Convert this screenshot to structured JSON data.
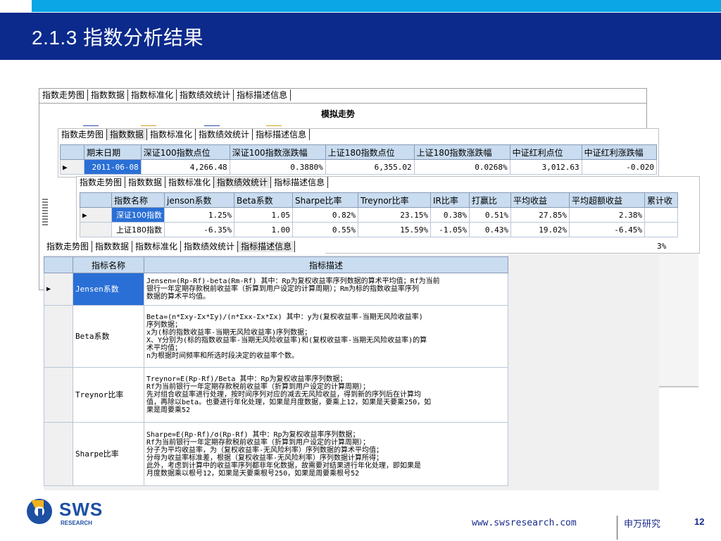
{
  "slide": {
    "title": "2.1.3 指数分析结果",
    "page_number": "12",
    "footer_url": "www.swsresearch.com",
    "footer_company": "申万研究",
    "logo_text": "SWS",
    "logo_subtext": "RESEARCH",
    "colors": {
      "header_band": "#0b2a8c",
      "top_strip": "#0aa6e6",
      "grid_header": "#c9dcf0",
      "selected": "#2a6fd6"
    }
  },
  "window1": {
    "tabs": [
      "指数走势图",
      "指数数据",
      "指数标准化",
      "指数绩效统计",
      "指标描述信息"
    ],
    "chart_title": "模拟走势"
  },
  "window2": {
    "tabs": [
      "指数走势图",
      "指数数据",
      "指数标准化",
      "指数绩效统计",
      "指标描述信息"
    ],
    "columns": [
      "期末日期",
      "深证100指数点位",
      "深证100指数涨跌幅",
      "上证180指数点位",
      "上证180指数涨跌幅",
      "中证红利点位",
      "中证红利涨跌幅"
    ],
    "rows": [
      [
        "2011-06-08",
        "4,266.48",
        "0.3880%",
        "6,355.02",
        "0.0268%",
        "3,012.63",
        "-0.020"
      ]
    ]
  },
  "window3": {
    "tabs": [
      "指数走势图",
      "指数数据",
      "指数标准化",
      "指数绩效统计",
      "指标描述信息"
    ],
    "columns": [
      "指数名称",
      "jenson系数",
      "Beta系数",
      "Sharpe比率",
      "Treynor比率",
      "IR比率",
      "打赢比",
      "平均收益",
      "平均超额收益",
      "累计收"
    ],
    "rows": [
      [
        "深证100指数",
        "1.25%",
        "1.05",
        "0.82%",
        "23.15%",
        "0.38%",
        "0.51%",
        "27.85%",
        "2.38%",
        ""
      ],
      [
        "上证180指数",
        "-6.35%",
        "1.00",
        "0.55%",
        "15.59%",
        "-1.05%",
        "0.43%",
        "19.02%",
        "-6.45%",
        ""
      ]
    ],
    "partial_value": "3%"
  },
  "window4": {
    "tabs": [
      "指数走势图",
      "指数数据",
      "指数标准化",
      "指数绩效统计",
      "指标描述信息"
    ],
    "columns": [
      "指标名称",
      "指标描述"
    ],
    "rows": [
      {
        "name": "Jensen系数",
        "desc": [
          "Jensen=(Rp-Rf)-beta(Rm-Rf)   其中：Rp为复权收益率序列数据的算术平均值；Rf为当前",
          "银行一年定期存款税前收益率（折算到用户设定的计算周期）；Rm为标的指数收益率序列",
          "数据的算术平均值。"
        ]
      },
      {
        "name": "Beta系数",
        "desc": [
          "Beta=(n*Σxy-Σx*Σy)/(n*Σxx-Σx*Σx)  其中：y为(复权收益率-当期无风险收益率)",
          "序列数据；",
          "x为(标的指数收益率-当期无风险收益率)序列数据；",
          "X、Y分别为(标的指数收益率-当期无风险收益率)和(复权收益率-当期无风险收益率)的算",
          "术平均值；",
          "n为根据时间频率和所选时段决定的收益率个数。"
        ]
      },
      {
        "name": "Treynor比率",
        "desc": [
          "Treynor=E(Rp-Rf)/Beta  其中：Rp为复权收益率序列数据；",
          "Rf为当前银行一年定期存款税前收益率（折算到用户设定的计算周期）；",
          "先对组合收益率进行处理，按时间序列对应的减去无风险收益，得到新的序列后在计算均",
          "值，再除以beta。也要进行年化处理，如果是月度数据，要乘上12，如果是天要乘250，如",
          "果是周要乘52"
        ]
      },
      {
        "name": "Sharpe比率",
        "desc": [
          "Sharpe=E(Rp-Rf)/σ(Rp-Rf)  其中：Rp为复权收益率序列数据；",
          "Rf为当前银行一年定期存款税前收益率（折算到用户设定的计算周期）；",
          "分子为平均收益率，为（复权收益率-无风险利率）序列数据的算术平均值；",
          "分母为收益率标准差，根据（复权收益率-无风险利率）序列数据计算所得；",
          "此外，考虑到计算中的收益率序列都非年化数据，故需要对结果进行年化处理，即如果是",
          "月度数据乘以根号12，如果是天要乘根号250，如果是周要乘根号52"
        ]
      }
    ]
  }
}
